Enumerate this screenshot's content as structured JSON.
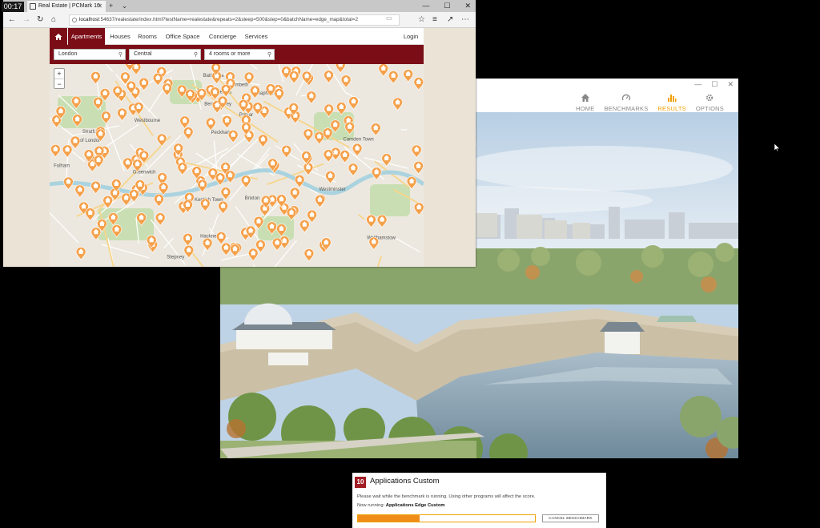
{
  "taskbar": {
    "time": "00:17"
  },
  "pcmark": {
    "window_buttons": [
      "—",
      "☐",
      "✕"
    ],
    "nav": [
      {
        "label": "HOME",
        "icon": "home-icon",
        "active": false
      },
      {
        "label": "BENCHMARKS",
        "icon": "gauge-icon",
        "active": false
      },
      {
        "label": "RESULTS",
        "icon": "bar-chart-icon",
        "active": true
      },
      {
        "label": "OPTIONS",
        "icon": "gear-icon",
        "active": false
      }
    ],
    "accent": "#f0a000"
  },
  "browser": {
    "tab_title": "Real Estate | PCMark 10",
    "tab_close": "✕",
    "new_tab": "+",
    "tab_menu": "⌄",
    "window_buttons": [
      "—",
      "☐",
      "✕"
    ],
    "address": {
      "host": "localhost",
      "path": ":54637/realestate/index.html?testName=realestate&repeats=2&sleep=500&step=0&batchName=edge_map&total=2"
    }
  },
  "site": {
    "brand_color": "#7b0d17",
    "nav": {
      "items": [
        "Apartments",
        "Houses",
        "Rooms",
        "Office Space",
        "Concierge",
        "Services"
      ],
      "active": "Apartments",
      "login": "Login"
    },
    "search": {
      "city": "London",
      "district": "Central",
      "rooms": "4 rooms or more"
    },
    "map": {
      "zoom_in": "+",
      "zoom_out": "−",
      "marker_color": "#f5a04a",
      "labels": [
        "Hackney",
        "Islington",
        "Camden Town",
        "Westbourne",
        "City of London",
        "Stepney",
        "Westminster",
        "Lambeth",
        "Bermondsey",
        "Peckham",
        "Greenwich",
        "Poplar",
        "Brixton",
        "Chelsea",
        "Fulham",
        "Battersea",
        "Clapham",
        "Stratford",
        "Kentish Town",
        "Walthamstow"
      ]
    }
  },
  "benchmark": {
    "logo": "10",
    "title": "Applications Custom",
    "message": "Please wait while the benchmark is running. Using other programs will affect the score.",
    "now_running_label": "Now running:",
    "now_running_value": "Applications Edge Custom",
    "progress": 0.35,
    "cancel_label": "CANCEL BENCHMARK"
  }
}
